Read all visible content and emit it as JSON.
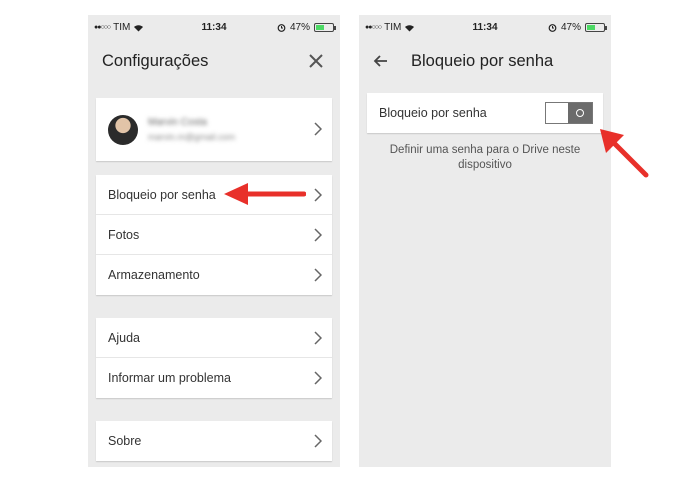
{
  "left_screen": {
    "status": {
      "carrier": "TIM",
      "time": "11:34",
      "battery": "47%"
    },
    "title": "Configurações",
    "account": {
      "name": "Marvin Costa",
      "email": "marvin.m@gmail.com"
    },
    "group1": [
      "Bloqueio por senha",
      "Fotos",
      "Armazenamento"
    ],
    "group2": [
      "Ajuda",
      "Informar um problema"
    ],
    "group3": [
      "Sobre"
    ]
  },
  "right_screen": {
    "status": {
      "carrier": "TIM",
      "time": "11:34",
      "battery": "47%"
    },
    "title": "Bloqueio por senha",
    "setting_label": "Bloqueio por senha",
    "toggle_on": false,
    "description": "Definir uma senha para o Drive neste dispositivo"
  },
  "colors": {
    "accent_arrow": "#e8302a",
    "background": "#ebebeb",
    "card": "#ffffff"
  },
  "icons": [
    "wifi-icon",
    "alarm-icon",
    "battery-icon",
    "close-icon",
    "back-arrow-icon",
    "chevron-right-icon"
  ]
}
